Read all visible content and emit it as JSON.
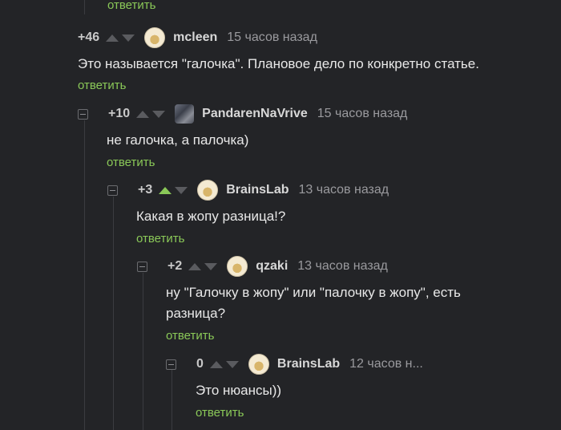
{
  "reply_label": "ответить",
  "comments": [
    {
      "rating": "+46",
      "username": "mcleen",
      "time": "15 часов назад",
      "text": "Это называется \"галочка\". Плановое дело по конкретно статье."
    },
    {
      "rating": "+10",
      "username": "PandarenNaVrive",
      "time": "15 часов назад",
      "text": "не галочка, а палочка)"
    },
    {
      "rating": "+3",
      "username": "BrainsLab",
      "time": "13 часов назад",
      "text": "Какая в жопу разница!?"
    },
    {
      "rating": "+2",
      "username": "qzaki",
      "time": "13 часов назад",
      "text_lines": [
        "ну \"Галочку в жопу\" или \"палочку в жопу\", есть",
        "разница?"
      ]
    },
    {
      "rating": "0",
      "username": "BrainsLab",
      "time": "12 часов н...",
      "text": "Это нюансы))"
    }
  ],
  "colors": {
    "background": "#232427",
    "accent_green": "#8ac858",
    "muted_text": "#9a9a9e"
  }
}
